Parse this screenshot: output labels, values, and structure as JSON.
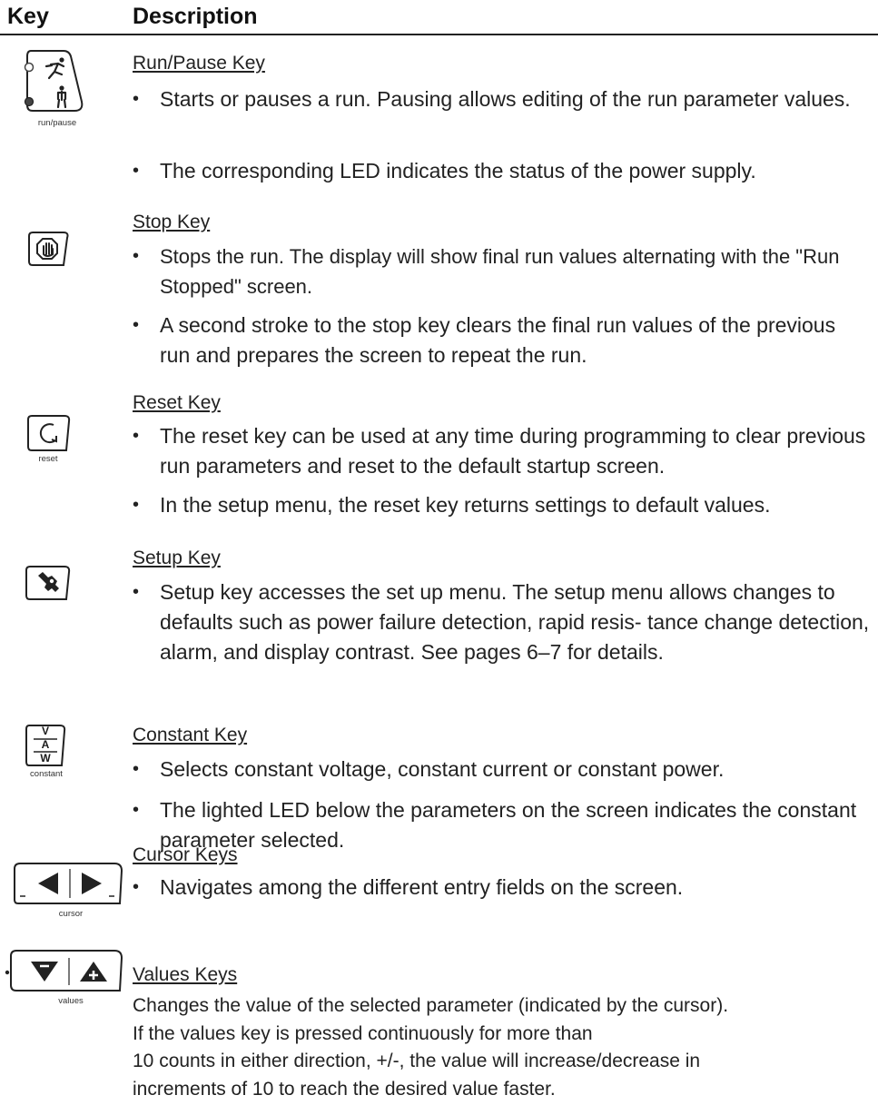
{
  "header": {
    "key": "Key",
    "description": "Description"
  },
  "sections": {
    "run_pause": {
      "title": "Run/Pause Key",
      "caption": "run/pause",
      "bullets": [
        "Starts or pauses a run. Pausing allows editing of the run parameter values.",
        "The corresponding LED indicates the status of the power supply."
      ]
    },
    "stop": {
      "title": "Stop Key",
      "bullets": [
        "Stops the run. The display will show final run values alternating with the \"Run Stopped\" screen.",
        "A second stroke to the stop key clears the final run values of the previous run and prepares the screen to repeat the run."
      ]
    },
    "reset": {
      "title": "Reset Key",
      "caption": "reset",
      "bullets": [
        "The reset key can be used at any time during programming to clear previous run parameters and reset to the default startup screen.",
        "In the setup menu, the reset key returns settings to default values."
      ]
    },
    "setup": {
      "title": "Setup Key",
      "bullets": [
        "Setup key accesses the set up menu. The setup menu allows changes to defaults such as power failure detection, rapid resis- tance change detection, alarm, and display contrast. See pages 6–7 for details."
      ]
    },
    "constant": {
      "title": "Constant Key",
      "caption": "constant",
      "key_letters": [
        "V",
        "A",
        "W"
      ],
      "bullets": [
        "Selects constant voltage, constant current or constant power.",
        "The lighted LED below the parameters on the screen indicates the constant parameter selected."
      ]
    },
    "cursor": {
      "title": "Cursor Keys",
      "caption": "cursor",
      "bullets": [
        "Navigates among the different entry fields on the screen."
      ]
    },
    "values": {
      "title": "Values Keys",
      "caption": "values",
      "lines": [
        "Changes the value of the selected parameter (indicated by the cursor).",
        "If the values key is pressed continuously for more than",
        "10 counts in either direction, +/-, the value will increase/decrease in",
        "increments of 10 to reach the desired value faster."
      ]
    }
  },
  "bullet_char": "•"
}
